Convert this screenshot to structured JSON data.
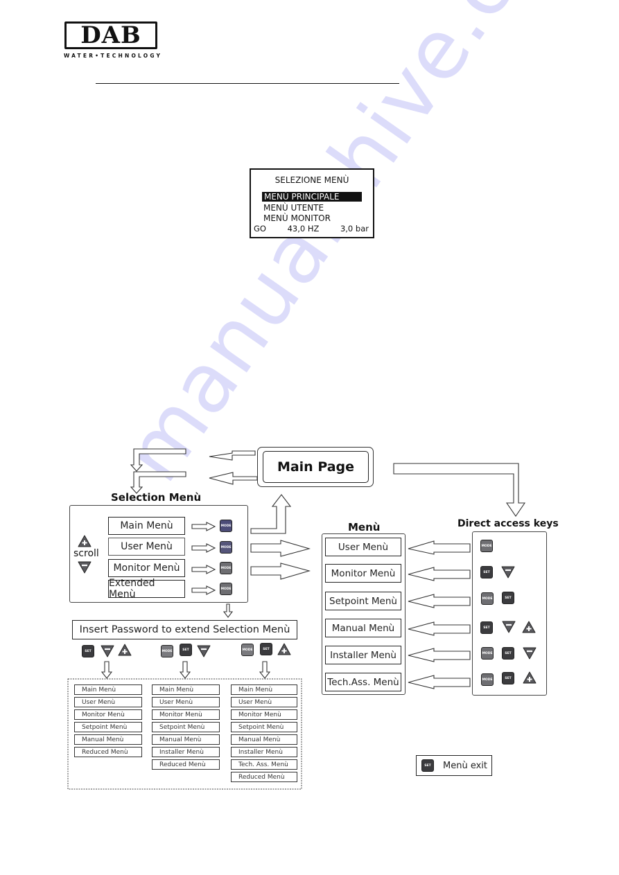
{
  "watermark": "manualshive.com",
  "logo": {
    "brand": "DAB",
    "tagline": "WATER•TECHNOLOGY"
  },
  "lcd": {
    "title": "SELEZIONE MENÙ",
    "items": [
      "MENÙ PRINCIPALE",
      "MENÙ UTENTE",
      "MENÙ MONITOR"
    ],
    "selected_index": 0,
    "status": {
      "state": "GO",
      "frequency": "43,0 HZ",
      "pressure": "3,0 bar"
    }
  },
  "diagram": {
    "main_page": "Main Page",
    "selection_menu": {
      "title": "Selection Menù",
      "scroll_label": "scroll",
      "items": [
        "Main Menù",
        "User Menù",
        "Monitor Menù",
        "Extended Menù"
      ],
      "key_label": "MODE"
    },
    "password_box": "Insert Password to extend Selection Menù",
    "password_combos": [
      {
        "keys": [
          "SET",
          "minus",
          "plus"
        ],
        "items": [
          "Main Menù",
          "User Menù",
          "Monitor Menù",
          "Setpoint Menù",
          "Manual Menù",
          "Reduced Menù"
        ]
      },
      {
        "keys": [
          "MODE",
          "SET",
          "minus"
        ],
        "items": [
          "Main Menù",
          "User Menù",
          "Monitor Menù",
          "Setpoint Menù",
          "Manual Menù",
          "Installer Menù",
          "Reduced Menù"
        ]
      },
      {
        "keys": [
          "MODE",
          "SET",
          "plus"
        ],
        "items": [
          "Main Menù",
          "User Menù",
          "Monitor Menù",
          "Setpoint Menù",
          "Manual Menù",
          "Installer Menù",
          "Tech. Ass. Menù",
          "Reduced Menù"
        ]
      }
    ],
    "menu": {
      "title": "Menù",
      "items": [
        "User Menù",
        "Monitor Menù",
        "Setpoint Menù",
        "Manual Menù",
        "Installer Menù",
        "Tech.Ass. Menù"
      ]
    },
    "direct_access": {
      "title": "Direct access keys",
      "rows": [
        [
          "MODE"
        ],
        [
          "SET",
          "minus"
        ],
        [
          "MODE",
          "SET"
        ],
        [
          "SET",
          "minus",
          "plus"
        ],
        [
          "MODE",
          "SET",
          "minus"
        ],
        [
          "MODE",
          "SET",
          "plus"
        ]
      ]
    },
    "legend": {
      "key": "SET",
      "label": "Menù exit"
    },
    "key_labels": {
      "mode": "MODE",
      "set": "SET"
    }
  }
}
